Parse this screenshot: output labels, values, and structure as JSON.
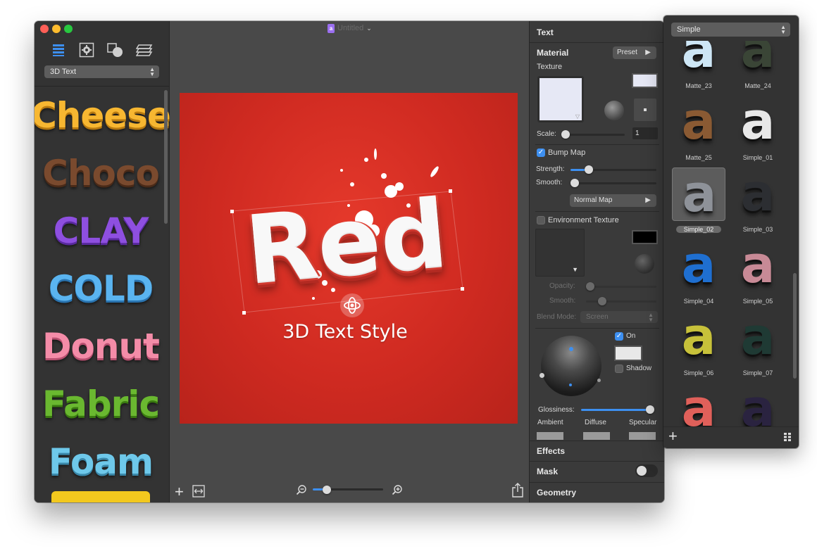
{
  "window": {
    "document_title": "Untitled",
    "colors": {
      "close": "#ff5f57",
      "minimize": "#febc2e",
      "zoom": "#28c840",
      "accent": "#3d8ff0"
    }
  },
  "sidebar": {
    "tools": [
      {
        "icon": "list-icon",
        "active": true
      },
      {
        "icon": "gear-icon",
        "active": false
      },
      {
        "icon": "shapes-icon",
        "active": false
      },
      {
        "icon": "layers-icon",
        "active": false
      }
    ],
    "category_select": "3D Text",
    "styles": [
      {
        "label": "Cheese",
        "color": "#f7b731"
      },
      {
        "label": "Choco",
        "color": "#7a4a2e"
      },
      {
        "label": "CLAY",
        "color": "#8e4fe0"
      },
      {
        "label": "COLD",
        "color": "#5ab4f0"
      },
      {
        "label": "Donut",
        "color": "#f48ca8"
      },
      {
        "label": "Fabric",
        "color": "#6ab830"
      },
      {
        "label": "Foam",
        "color": "#6ec8ea"
      }
    ]
  },
  "canvas": {
    "headline": "Red",
    "subtitle": "3D Text Style",
    "zoom_fraction": 0.2
  },
  "inspector": {
    "text_section": "Text",
    "material_section": "Material",
    "preset_button": "Preset",
    "texture_label": "Texture",
    "scale_label": "Scale:",
    "scale_value": "1",
    "bump_map_label": "Bump Map",
    "bump_map_checked": true,
    "strength_label": "Strength:",
    "smooth_label": "Smooth:",
    "normal_map_button": "Normal Map",
    "env_texture_label": "Environment Texture",
    "env_texture_checked": false,
    "opacity_label": "Opacity:",
    "smooth2_label": "Smooth:",
    "blend_mode_label": "Blend Mode:",
    "blend_mode_value": "Screen",
    "on_label": "On",
    "on_checked": true,
    "shadow_label": "Shadow",
    "shadow_checked": false,
    "glossiness_label": "Glossiness:",
    "ambient_label": "Ambient",
    "diffuse_label": "Diffuse",
    "specular_label": "Specular",
    "effects_section": "Effects",
    "mask_section": "Mask",
    "geometry_section": "Geometry"
  },
  "presets": {
    "select": "Simple",
    "items": [
      {
        "name": "Matte_23",
        "color": "#cde6f5",
        "selected": false
      },
      {
        "name": "Matte_24",
        "color": "#3a4536",
        "selected": false
      },
      {
        "name": "Matte_25",
        "color": "#8a5a33",
        "selected": false
      },
      {
        "name": "Simple_01",
        "color": "#e8e8e8",
        "selected": false
      },
      {
        "name": "Simple_02",
        "color": "#8e9299",
        "selected": true
      },
      {
        "name": "Simple_03",
        "color": "#2c2e32",
        "selected": false
      },
      {
        "name": "Simple_04",
        "color": "#1f6fd0",
        "selected": false
      },
      {
        "name": "Simple_05",
        "color": "#c88a96",
        "selected": false
      },
      {
        "name": "Simple_06",
        "color": "#c7c13a",
        "selected": false
      },
      {
        "name": "Simple_07",
        "color": "#1f3a34",
        "selected": false
      },
      {
        "name": "",
        "color": "#e0605a",
        "selected": false
      },
      {
        "name": "",
        "color": "#2a2340",
        "selected": false
      }
    ]
  }
}
